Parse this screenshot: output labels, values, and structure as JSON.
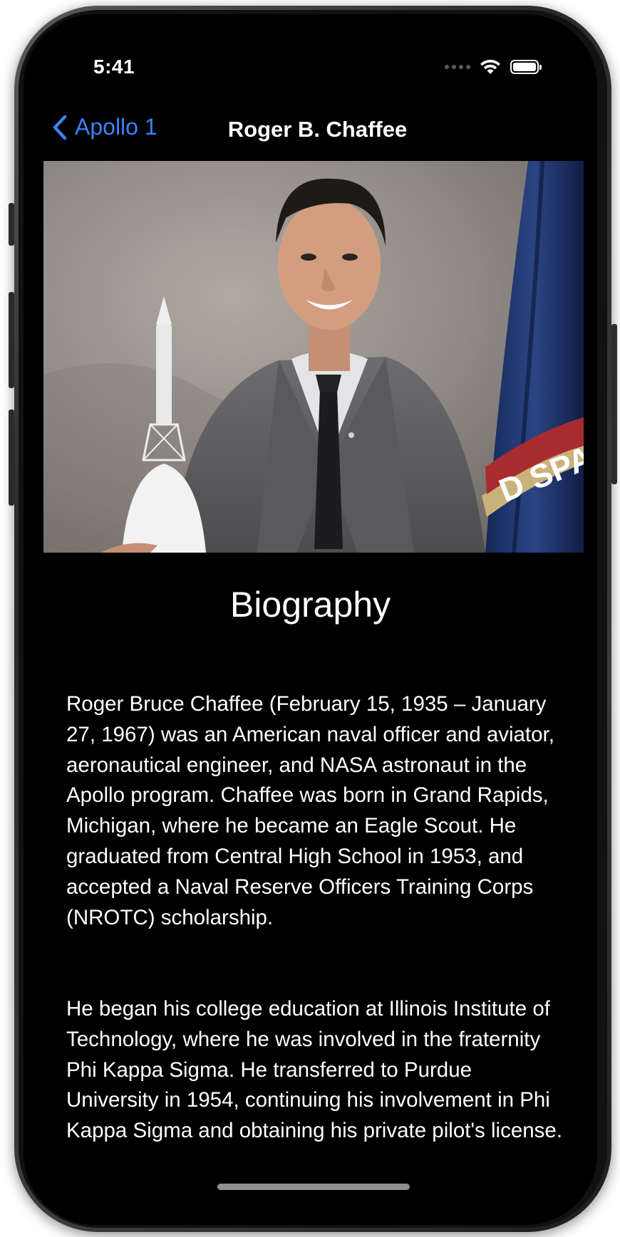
{
  "status_bar": {
    "time": "5:41"
  },
  "navbar": {
    "back_label": "Apollo 1",
    "title": "Roger B. Chaffee",
    "accent_color": "#3a82f7"
  },
  "photo": {
    "flag_text": "D SPACE L"
  },
  "biography": {
    "heading": "Biography",
    "paragraphs": [
      "Roger Bruce Chaffee (February 15, 1935 – January 27, 1967) was an American naval officer and aviator, aeronautical engineer, and NASA astronaut in the Apollo program. Chaffee was born in Grand Rapids, Michigan, where he became an Eagle Scout. He graduated from Central High School in 1953, and accepted a Naval Reserve Officers Training Corps (NROTC) scholarship.",
      "He began his college education at Illinois Institute of Technology, where he was involved in the fraternity Phi Kappa Sigma. He transferred to Purdue University in 1954, continuing his involvement in Phi Kappa Sigma and obtaining his private pilot's license."
    ]
  }
}
